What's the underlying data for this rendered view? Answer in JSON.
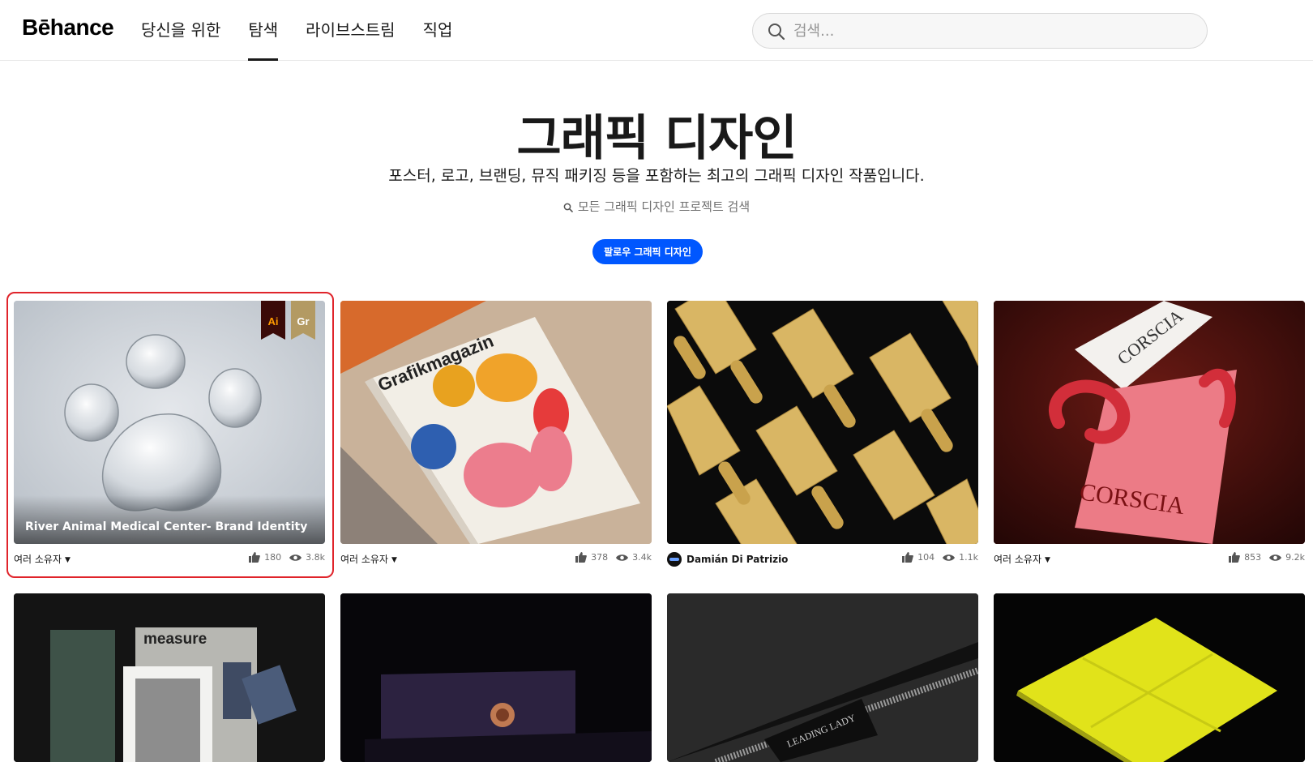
{
  "header": {
    "logo": "Bēhance",
    "nav": [
      {
        "label": "당신을 위한",
        "active": false
      },
      {
        "label": "탐색",
        "active": true
      },
      {
        "label": "라이브스트림",
        "active": false
      },
      {
        "label": "직업",
        "active": false
      }
    ],
    "search_placeholder": "검색..."
  },
  "hero": {
    "title": "그래픽 디자인",
    "subtitle": "포스터, 로고, 브랜딩, 뮤직 패키징 등을 포함하는 최고의 그래픽 디자인 작품입니다.",
    "search_link": "모든 그래픽 디자인 프로젝트 검색",
    "follow_label": "팔로우 그래픽 디자인"
  },
  "colors": {
    "accent": "#0057ff",
    "highlight": "#e0242b"
  },
  "cards": [
    {
      "title": "River Animal Medical Center- Brand Identity",
      "owner": "여러 소유자",
      "likes": "180",
      "views": "3.8k",
      "badges": [
        "Ai",
        "Gr"
      ],
      "icon": "paw-drops-image"
    },
    {
      "title": "",
      "owner": "여러 소유자",
      "likes": "378",
      "views": "3.4k",
      "icon": "magazine-image"
    },
    {
      "title": "",
      "owner": "Damián Di Patrizio",
      "likes": "104",
      "views": "1.1k",
      "icon": "gold-bottles-image"
    },
    {
      "title": "",
      "owner": "여러 소유자",
      "likes": "853",
      "views": "9.2k",
      "icon": "pink-card-image"
    },
    {
      "title": "",
      "icon": "measure-stationery-image",
      "thumb_text": "measure"
    },
    {
      "title": "",
      "icon": "purple-box-image"
    },
    {
      "title": "",
      "icon": "leather-pouch-image",
      "thumb_text": "LEADING LADY"
    },
    {
      "title": "",
      "icon": "yellow-book-image"
    }
  ]
}
